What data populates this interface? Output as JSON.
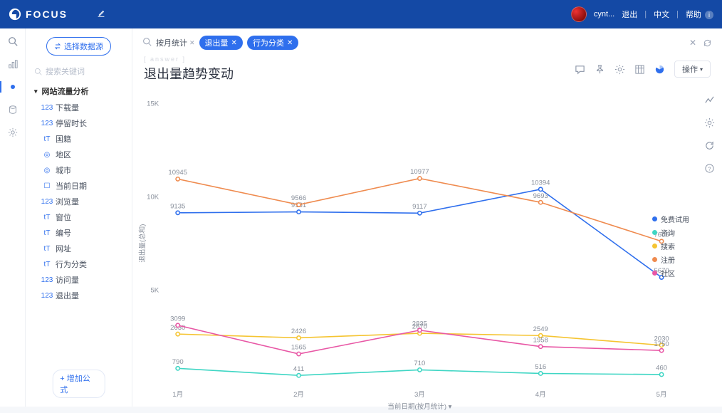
{
  "header": {
    "brand": "FOCUS",
    "user": "cynt...",
    "logout": "退出",
    "lang": "中文",
    "help": "帮助"
  },
  "side": {
    "select_ds": "选择数据源",
    "search_placeholder": "搜索关键词",
    "tree_root": "网站流量分析",
    "fields": [
      {
        "icon": "num",
        "label": "下载量"
      },
      {
        "icon": "num",
        "label": "停留时长"
      },
      {
        "icon": "txt",
        "label": "国籍"
      },
      {
        "icon": "geo",
        "label": "地区"
      },
      {
        "icon": "geo",
        "label": "城市"
      },
      {
        "icon": "date",
        "label": "当前日期"
      },
      {
        "icon": "num",
        "label": "浏览量"
      },
      {
        "icon": "txt",
        "label": "窗位"
      },
      {
        "icon": "txt",
        "label": "编号"
      },
      {
        "icon": "txt",
        "label": "网址"
      },
      {
        "icon": "txt",
        "label": "行为分类"
      },
      {
        "icon": "num",
        "label": "访问量"
      },
      {
        "icon": "num",
        "label": "退出量"
      }
    ],
    "add_formula": "+  增加公式"
  },
  "query": {
    "chip_plain": "按月统计",
    "chips": [
      "退出量",
      "行为分类"
    ]
  },
  "title": {
    "answer": "[ answer ]",
    "text": "退出量趋势变动",
    "ops": "操作"
  },
  "chart_data": {
    "type": "line",
    "title": "退出量趋势变动",
    "xlabel": "当前日期(按月统计)",
    "ylabel": "退出量(总和)",
    "categories": [
      "1月",
      "2月",
      "3月",
      "4月",
      "5月"
    ],
    "ylim": [
      0,
      15000
    ],
    "yticks": [
      5000,
      10000,
      15000
    ],
    "ytick_labels": [
      "5K",
      "10K",
      "15K"
    ],
    "legend_position": "right",
    "series": [
      {
        "name": "免费试用",
        "color": "#2f6fed",
        "values": [
          9135,
          9181,
          9117,
          10394,
          5670
        ]
      },
      {
        "name": "咨询",
        "color": "#3fd6c4",
        "values": [
          790,
          411,
          710,
          516,
          460
        ]
      },
      {
        "name": "搜索",
        "color": "#f5c431",
        "values": [
          2630,
          2426,
          2670,
          2549,
          2030
        ]
      },
      {
        "name": "注册",
        "color": "#ef8b4f",
        "values": [
          10945,
          9566,
          10977,
          9693,
          7606
        ]
      },
      {
        "name": "社区",
        "color": "#e857a5",
        "values": [
          3099,
          1565,
          2835,
          1958,
          1750
        ]
      }
    ],
    "data_labels": {
      "免费试用": [
        9135,
        9181,
        9117,
        10394,
        5670
      ],
      "咨询": [
        790,
        411,
        710,
        516,
        460
      ],
      "搜索": [
        2630,
        2426,
        2670,
        2549,
        2030
      ],
      "注册": [
        10945,
        9566,
        10977,
        9693,
        7606
      ],
      "社区": [
        3099,
        1565,
        2835,
        1958,
        1750
      ]
    }
  }
}
